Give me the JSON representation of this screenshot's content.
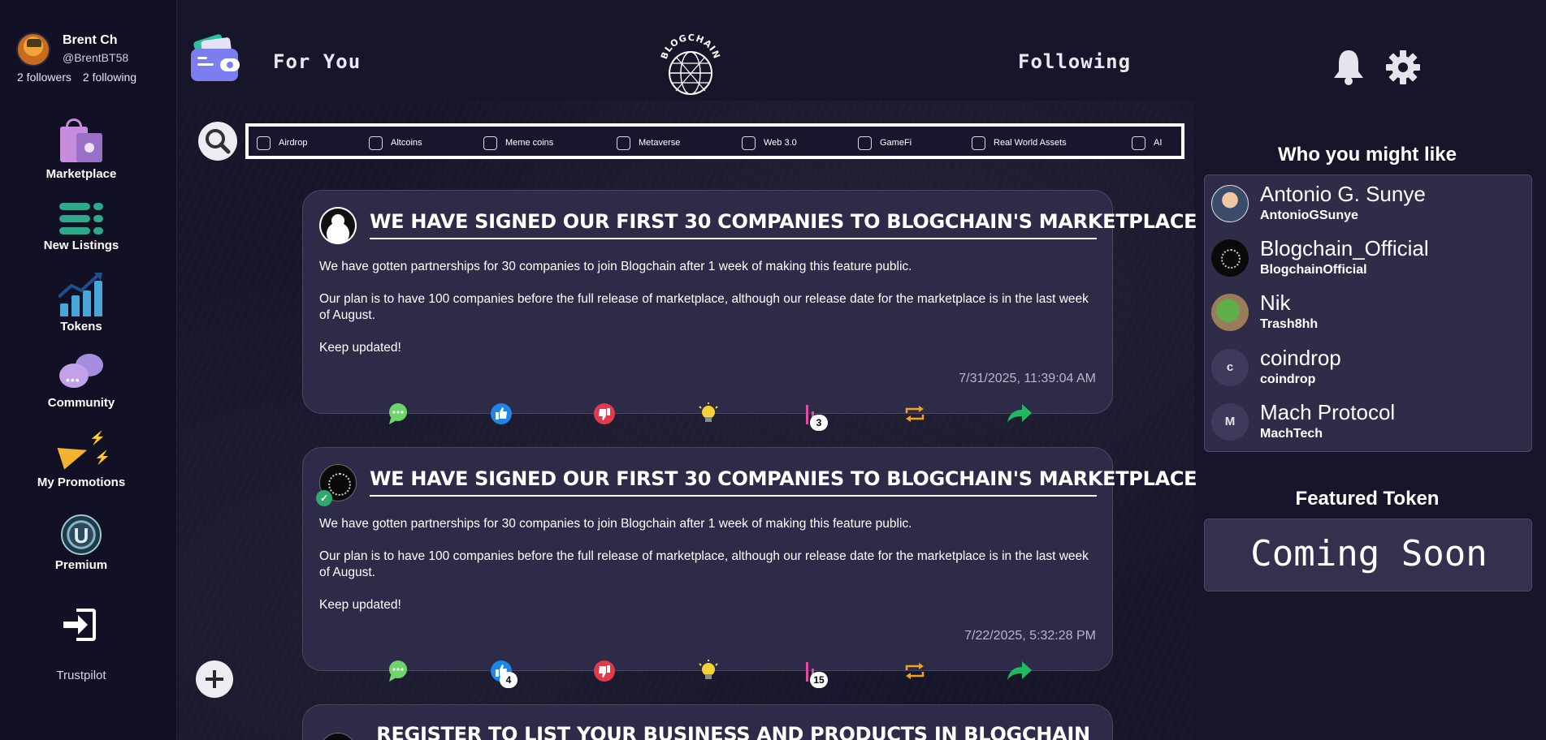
{
  "profile": {
    "name": "Brent Ch",
    "handle": "@BrentBT58",
    "followers": "2 followers",
    "following": "2 following"
  },
  "sidebar": {
    "items": [
      {
        "label": "Marketplace",
        "icon": "shopping-bag-icon"
      },
      {
        "label": "New Listings",
        "icon": "list-icon"
      },
      {
        "label": "Tokens",
        "icon": "chart-icon"
      },
      {
        "label": "Community",
        "icon": "chat-bubbles-icon"
      },
      {
        "label": "My Promotions",
        "icon": "megaphone-icon"
      },
      {
        "label": "Premium",
        "icon": "premium-badge-icon"
      }
    ],
    "logout_icon": "logout-icon",
    "trustpilot": "Trustpilot"
  },
  "header": {
    "tab_for_you": "For You",
    "tab_following": "Following",
    "logo_text": "BLOGCHAIN"
  },
  "filters": [
    "Airdrop",
    "Altcoins",
    "Meme coins",
    "Metaverse",
    "Web 3.0",
    "GameFi",
    "Real World Assets",
    "AI"
  ],
  "posts": [
    {
      "title": "WE HAVE SIGNED OUR FIRST 30 COMPANIES TO BLOGCHAIN'S MARKETPLACE",
      "p1": "We have gotten partnerships for 30 companies to join Blogchain after 1 week of making this feature public.",
      "p2": "Our plan is to have 100 companies before the full release of marketplace, although our release date for the marketplace is in the last week of August.",
      "p3": "Keep updated!",
      "date": "7/31/2025, 11:39:04 AM",
      "like_count": "",
      "views_count": "3"
    },
    {
      "title": "WE HAVE SIGNED OUR FIRST 30 COMPANIES TO BLOGCHAIN'S MARKETPLACE",
      "p1": "We have gotten partnerships for 30 companies to join Blogchain after 1 week of making this feature public.",
      "p2": "Our plan is to have 100 companies before the full release of marketplace, although our release date for the marketplace is in the last week of August.",
      "p3": "Keep updated!",
      "date": "7/22/2025, 5:32:28 PM",
      "like_count": "4",
      "views_count": "15"
    },
    {
      "title": "REGISTER TO LIST YOUR BUSINESS AND PRODUCTS IN BLOGCHAIN"
    }
  ],
  "right": {
    "who_title": "Who you might like",
    "suggestions": [
      {
        "name": "Antonio G. Sunye",
        "handle": "AntonioGSunye"
      },
      {
        "name": "Blogchain_Official",
        "handle": "BlogchainOfficial"
      },
      {
        "name": "Nik",
        "handle": "Trash8hh"
      },
      {
        "name": "coindrop",
        "handle": "coindrop",
        "initial": "c"
      },
      {
        "name": "Mach Protocol",
        "handle": "MachTech",
        "initial": "M"
      }
    ],
    "featured_title": "Featured Token",
    "featured_text": "Coming Soon"
  },
  "colors": {
    "background": "#16152a",
    "sidebar": "#111024",
    "card": "#2e2b48",
    "like_blue": "#1e86e8",
    "dislike_red": "#e23a4a",
    "chat_green": "#6fd56a",
    "idea_yellow": "#f4d23a",
    "views_pink": "#e64aa8",
    "repost_orange": "#f2a21c",
    "share_green": "#22b860"
  }
}
